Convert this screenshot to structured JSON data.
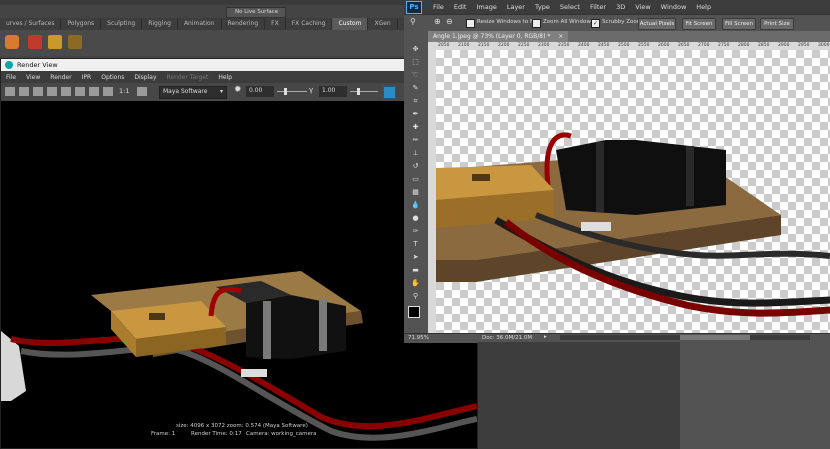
{
  "maya": {
    "shelf_tabs": [
      "urves / Surfaces",
      "Polygons",
      "Sculpting",
      "Rigging",
      "Animation",
      "Rendering",
      "FX",
      "FX Caching",
      "Custom",
      "XGen"
    ],
    "active_shelf_tab": "Custom",
    "no_live_surface": "No Live Surface",
    "render_view": {
      "title": "Render View",
      "menus": [
        "File",
        "View",
        "Render",
        "IPR",
        "Options",
        "Display",
        "Render Target",
        "Help"
      ],
      "dim_menu": "Render Target",
      "ratio_label": "1:1",
      "renderer": "Maya Software",
      "exposure": "0.00",
      "gamma": "1.00",
      "info_size": "size: 4096 x 3072  zoom: 0.574       (Maya Software)",
      "info_frame": "Frame: 1",
      "info_render_time": "Render Time: 0:17",
      "info_camera": "Camera: working_camera"
    }
  },
  "photoshop": {
    "logo": "Ps",
    "menus": [
      "File",
      "Edit",
      "Image",
      "Layer",
      "Type",
      "Select",
      "Filter",
      "3D",
      "View",
      "Window",
      "Help"
    ],
    "options": {
      "resize_windows": "Resize Windows to Fit",
      "zoom_all": "Zoom All Windows",
      "scrubby_zoom": "Scrubby Zoom",
      "scrubby_checked": true,
      "actual_pixels": "Actual Pixels",
      "fit_screen": "Fit Screen",
      "fill_screen": "Fill Screen",
      "print_size": "Print Size"
    },
    "doc_tab": "Angle 1.jpeg @ 73% (Layer 0, RGB/8) *",
    "ruler_ticks": [
      "2050",
      "2100",
      "2150",
      "2200",
      "2250",
      "2300",
      "2350",
      "2400",
      "2450",
      "2500",
      "2550",
      "2600",
      "2650",
      "2700",
      "2750",
      "2800",
      "2850",
      "2900",
      "2950",
      "3000"
    ],
    "status_zoom": "71.95%",
    "status_doc": "Doc: 36.0M/21.0M"
  },
  "colors": {
    "wood": "#8a6a3e",
    "controller": "#c9973f",
    "battery": "#141414",
    "cable_red": "#8b0000",
    "cable_grey": "#4a4a4a"
  }
}
